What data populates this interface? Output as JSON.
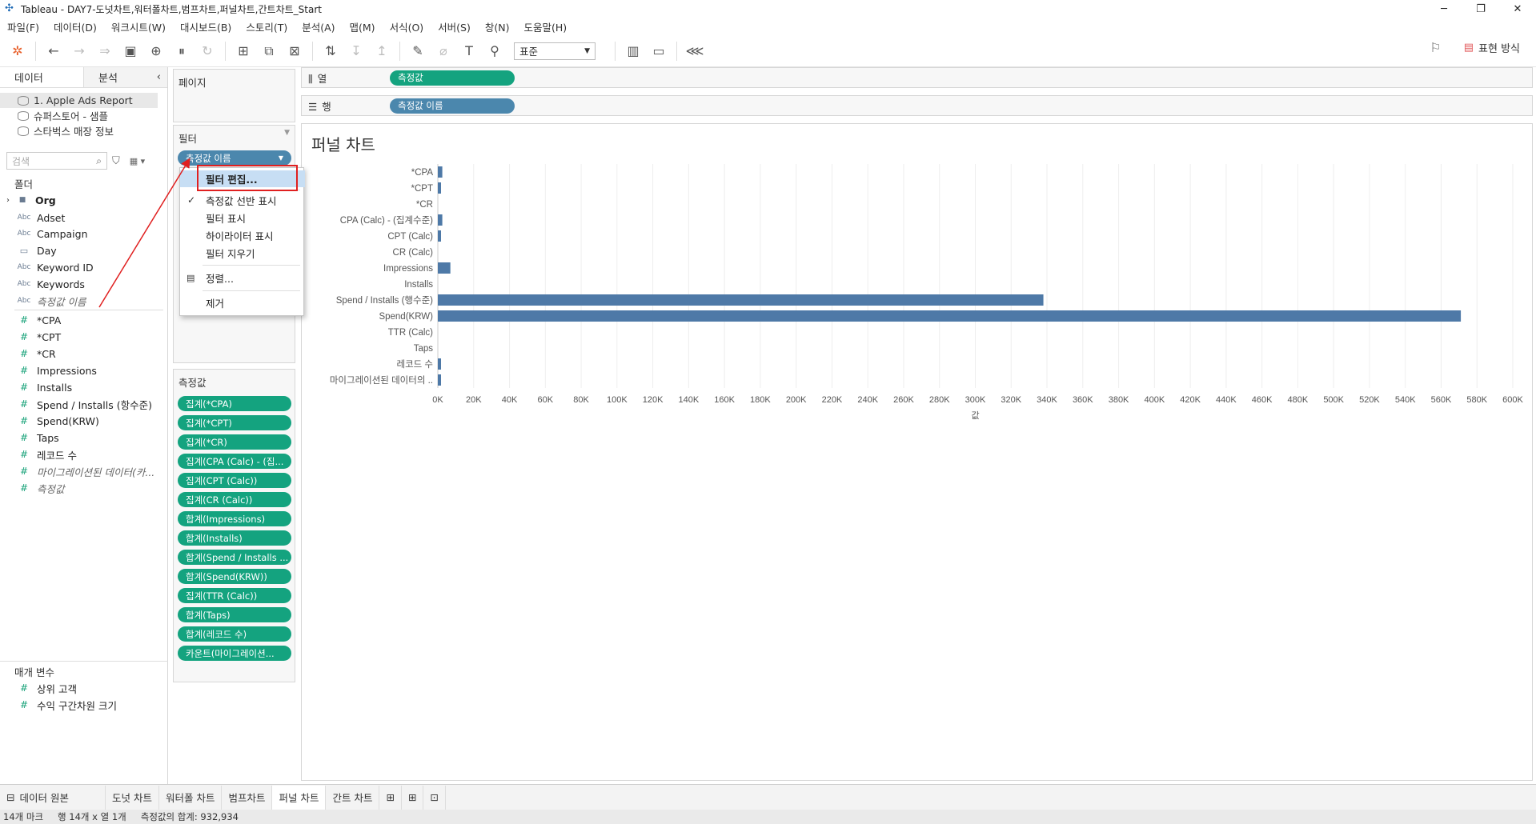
{
  "window": {
    "title": "Tableau - DAY7-도넛차트,워터폴차트,범프차트,퍼널차트,간트차트_Start"
  },
  "menu": [
    "파일(F)",
    "데이터(D)",
    "워크시트(W)",
    "대시보드(B)",
    "스토리(T)",
    "분석(A)",
    "맵(M)",
    "서식(O)",
    "서버(S)",
    "창(N)",
    "도움말(H)"
  ],
  "toolbar": {
    "fit": "표준",
    "show_me": "표현 방식"
  },
  "data_pane": {
    "tab_data": "데이터",
    "tab_analysis": "분석",
    "sources": [
      "1. Apple Ads Report",
      "슈퍼스토어 - 샘플",
      "스타벅스 매장 정보"
    ],
    "search_placeholder": "검색",
    "folder_label": "폴더",
    "dimensions": [
      {
        "icon": "folder",
        "name": "Org"
      },
      {
        "icon": "Abc",
        "name": "Adset"
      },
      {
        "icon": "Abc",
        "name": "Campaign"
      },
      {
        "icon": "date",
        "name": "Day"
      },
      {
        "icon": "Abc",
        "name": "Keyword ID"
      },
      {
        "icon": "Abc",
        "name": "Keywords"
      },
      {
        "icon": "Abc",
        "name": "측정값 이름"
      }
    ],
    "measures": [
      "*CPA",
      "*CPT",
      "*CR",
      "Impressions",
      "Installs",
      "Spend / Installs (항수준)",
      "Spend(KRW)",
      "Taps",
      "레코드 수",
      "마이그레이션된 데이터(카...",
      "측정값"
    ],
    "params_label": "매개 변수",
    "params": [
      "상위 고객",
      "수익 구간차원 크기"
    ]
  },
  "shelves": {
    "pages": "페이지",
    "filters": "필터",
    "filter_pill": "측정값 이름",
    "measures_title": "측정값",
    "measure_pills": [
      "집계(*CPA)",
      "집계(*CPT)",
      "집계(*CR)",
      "집계(CPA (Calc) - (집...",
      "집계(CPT (Calc))",
      "집계(CR (Calc))",
      "합계(Impressions)",
      "합계(Installs)",
      "합계(Spend / Installs ...",
      "합계(Spend(KRW))",
      "집계(TTR (Calc))",
      "합계(Taps)",
      "합계(레코드 수)",
      "카운트(마이그레이션..."
    ],
    "columns_label": "열",
    "columns_pill": "측정값",
    "rows_label": "행",
    "rows_pill": "측정값 이름"
  },
  "context_menu": [
    "필터 편집...",
    "측정값 선반 표시",
    "필터 표시",
    "하이라이터 표시",
    "필터 지우기",
    "정렬...",
    "제거"
  ],
  "view": {
    "title": "퍼널 차트"
  },
  "chart_data": {
    "type": "bar",
    "orientation": "horizontal",
    "categories": [
      "*CPA",
      "*CPT",
      "*CR",
      "CPA (Calc) - (집계수준)",
      "CPT (Calc)",
      "CR (Calc)",
      "Impressions",
      "Installs",
      "Spend / Installs (행수준)",
      "Spend(KRW)",
      "TTR (Calc)",
      "Taps",
      "레코드 수",
      "마이그레이션된 데이터의 .."
    ],
    "values": [
      2500,
      1000,
      0,
      2500,
      1000,
      0,
      7000,
      0,
      338000,
      571000,
      0,
      0,
      1200,
      900
    ],
    "xlim": [
      0,
      600000
    ],
    "xticks": [
      "0K",
      "20K",
      "40K",
      "60K",
      "80K",
      "100K",
      "120K",
      "140K",
      "160K",
      "180K",
      "200K",
      "220K",
      "240K",
      "260K",
      "280K",
      "300K",
      "320K",
      "340K",
      "360K",
      "380K",
      "400K",
      "420K",
      "440K",
      "460K",
      "480K",
      "500K",
      "520K",
      "540K",
      "560K",
      "580K",
      "600K"
    ],
    "xlabel": "값",
    "bar_color": "#4e79a7",
    "grid": true
  },
  "sheet_tabs": [
    "데이터 원본",
    "도넛 차트",
    "워터폴 차트",
    "범프차트",
    "퍼널 차트",
    "간트 차트"
  ],
  "status": {
    "marks": "14개 마크",
    "rows_cols": "행 14개 x 열 1개",
    "sum": "측정값의 합계: 932,934"
  }
}
